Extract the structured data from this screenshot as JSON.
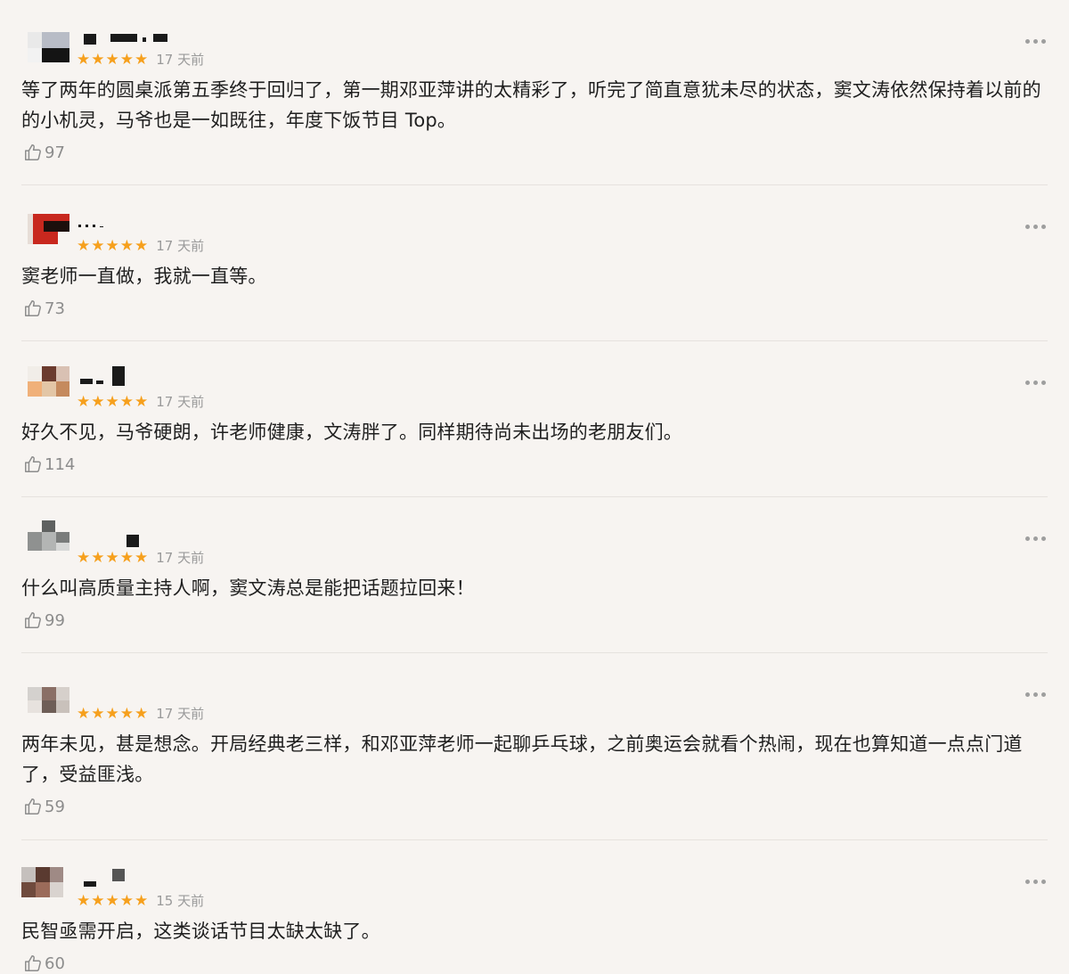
{
  "comments": [
    {
      "rating": 5,
      "time": "17 天前",
      "text": "等了两年的圆桌派第五季终于回归了，第一期邓亚萍讲的太精彩了，听完了简直意犹未尽的状态，窦文涛依然保持着以前的的小机灵，马爷也是一如既往，年度下饭节目 Top。",
      "likes": "97"
    },
    {
      "rating": 5,
      "time": "17 天前",
      "text": "窦老师一直做，我就一直等。",
      "likes": "73"
    },
    {
      "rating": 5,
      "time": "17 天前",
      "text": "好久不见，马爷硬朗，许老师健康，文涛胖了。同样期待尚未出场的老朋友们。",
      "likes": "114"
    },
    {
      "rating": 5,
      "time": "17 天前",
      "text": "什么叫高质量主持人啊，窦文涛总是能把话题拉回来！",
      "likes": "99"
    },
    {
      "rating": 5,
      "time": "17 天前",
      "text": "两年未见，甚是想念。开局经典老三样，和邓亚萍老师一起聊乒乓球，之前奥运会就看个热闹，现在也算知道一点点门道了，受益匪浅。",
      "likes": "59"
    },
    {
      "rating": 5,
      "time": "15 天前",
      "text": "民智亟需开启，这类谈话节目太缺太缺了。",
      "likes": "60"
    }
  ],
  "colors": {
    "background": "#f7f4f1",
    "star": "#f6a01d",
    "time": "#9a9a9a",
    "like": "#8c8c8c",
    "divider": "#e6e2de"
  },
  "icons": {
    "like": "thumbs-up-icon",
    "more": "more-dots-icon",
    "star": "star-icon"
  }
}
